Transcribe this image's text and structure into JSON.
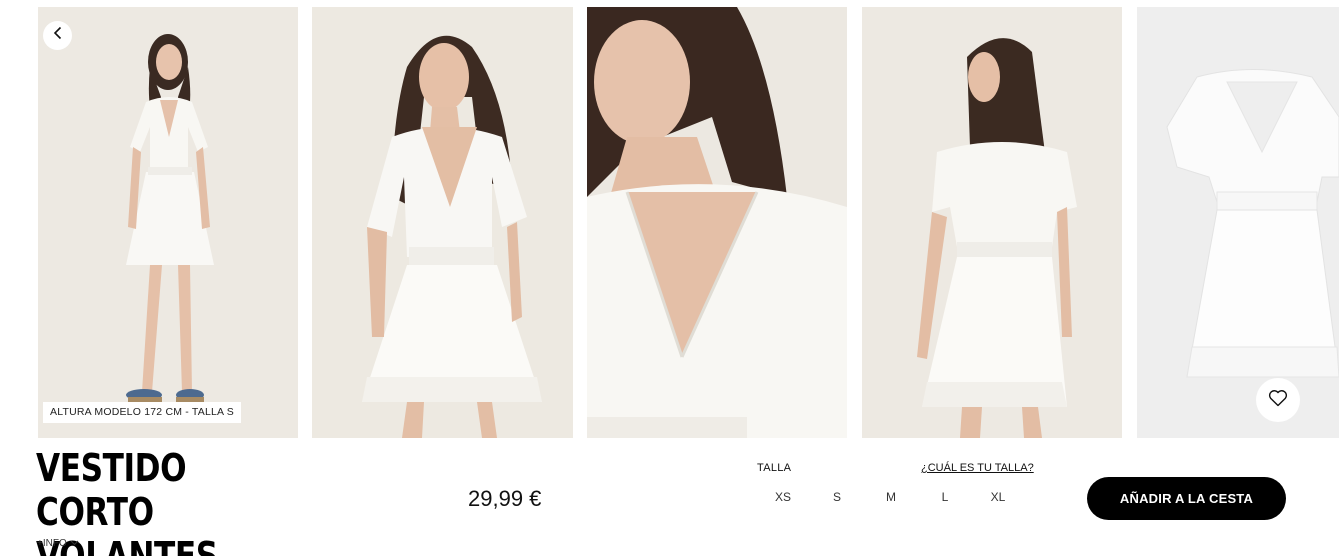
{
  "gallery": {
    "model_info": "ALTURA MODELO 172 CM - TALLA S",
    "photos": [
      {
        "name": "product-photo-full-front"
      },
      {
        "name": "product-photo-front-pose"
      },
      {
        "name": "product-photo-closeup-neckline"
      },
      {
        "name": "product-photo-back"
      },
      {
        "name": "product-photo-flat-lay"
      }
    ]
  },
  "product": {
    "title": "VESTIDO CORTO VOLANTES",
    "more_info": "+INFO",
    "price": "29,99 €"
  },
  "sizes": {
    "label": "TALLA",
    "guide_link": "¿CUÁL ES TU TALLA?",
    "options": [
      "XS",
      "S",
      "M",
      "L",
      "XL"
    ]
  },
  "actions": {
    "add_to_cart": "AÑADIR A LA CESTA"
  },
  "colors": {
    "accent": "#000000",
    "background": "#ffffff",
    "photo_bg": "#ede9e2"
  },
  "icons": {
    "back": "chevron-left-icon",
    "favorite": "heart-icon",
    "expand": "chevron-down-icon"
  }
}
